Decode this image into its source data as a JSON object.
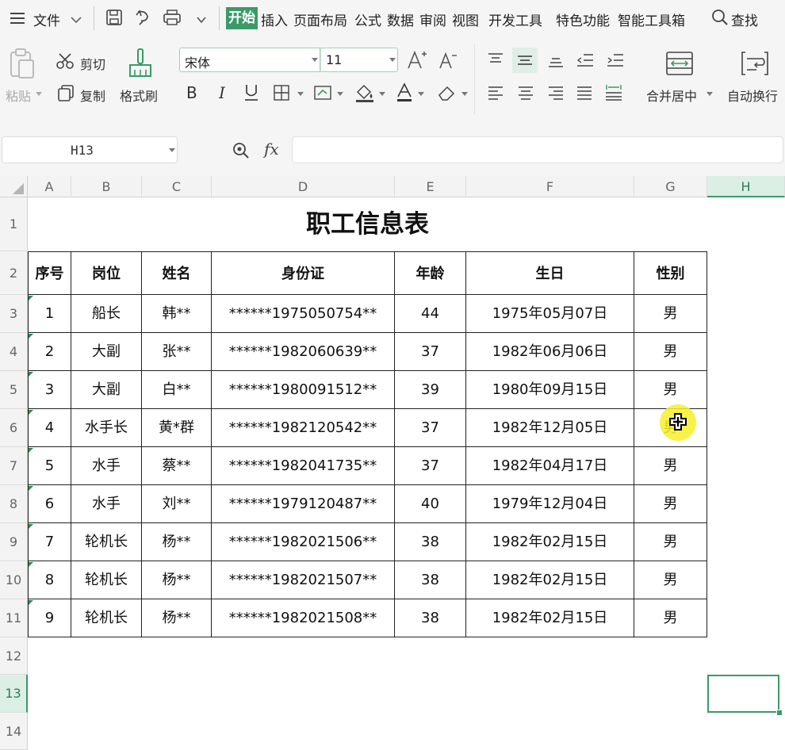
{
  "menu": {
    "file_label": "文件",
    "tabs": [
      "开始",
      "插入",
      "页面布局",
      "公式",
      "数据",
      "审阅",
      "视图",
      "开发工具",
      "特色功能",
      "智能工具箱"
    ],
    "search_label": "查找"
  },
  "ribbon": {
    "paste_label": "粘贴",
    "cut_label": "剪切",
    "copy_label": "复制",
    "format_painter_label": "格式刷",
    "font_name": "宋体",
    "font_size": "11",
    "merge_center_label": "合并居中",
    "wrap_text_label": "自动换行"
  },
  "formula_bar": {
    "name_box": "H13",
    "fx_label": "fx",
    "formula_value": ""
  },
  "sheet": {
    "columns": [
      "A",
      "B",
      "C",
      "D",
      "E",
      "F",
      "G",
      "H"
    ],
    "rows": [
      "1",
      "2",
      "3",
      "4",
      "5",
      "6",
      "7",
      "8",
      "9",
      "10",
      "11",
      "12",
      "13",
      "14"
    ],
    "selected_column": "H",
    "selected_row": "13",
    "title": "职工信息表",
    "headers": [
      "序号",
      "岗位",
      "姓名",
      "身份证",
      "年龄",
      "生日",
      "性别"
    ],
    "data": [
      [
        "1",
        "船长",
        "韩**",
        "******1975050754**",
        "44",
        "1975年05月07日",
        "男"
      ],
      [
        "2",
        "大副",
        "张**",
        "******1982060639**",
        "37",
        "1982年06月06日",
        "男"
      ],
      [
        "3",
        "大副",
        "白**",
        "******1980091512**",
        "39",
        "1980年09月15日",
        "男"
      ],
      [
        "4",
        "水手长",
        "黄*群",
        "******1982120542**",
        "37",
        "1982年12月05日",
        "男"
      ],
      [
        "5",
        "水手",
        "蔡**",
        "******1982041735**",
        "37",
        "1982年04月17日",
        "男"
      ],
      [
        "6",
        "水手",
        "刘**",
        "******1979120487**",
        "40",
        "1979年12月04日",
        "男"
      ],
      [
        "7",
        "轮机长",
        "杨**",
        "******1982021506**",
        "38",
        "1982年02月15日",
        "男"
      ],
      [
        "8",
        "轮机长",
        "杨**",
        "******1982021507**",
        "38",
        "1982年02月15日",
        "男"
      ],
      [
        "9",
        "轮机长",
        "杨**",
        "******1982021508**",
        "38",
        "1982年02月15日",
        "男"
      ]
    ]
  },
  "colors": {
    "accent": "#3a9a68",
    "active_tab_bg": "#3a9a68",
    "cursor_highlight": "#f7ee2a"
  }
}
